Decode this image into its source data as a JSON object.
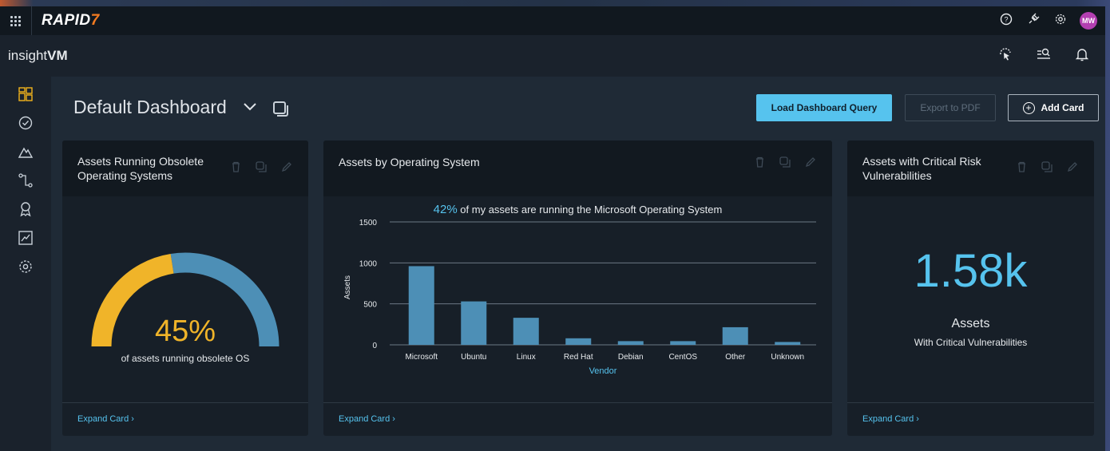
{
  "brand": {
    "name": "RAPID",
    "mark": "7",
    "product_prefix": "insight",
    "product_suffix": "VM",
    "avatar_initials": "MW"
  },
  "brandbar_icons": [
    "help-icon",
    "plug-icon",
    "gear-icon"
  ],
  "productbar_icons": [
    "scan-cursor-icon",
    "search-list-icon",
    "bell-icon"
  ],
  "sidebar": {
    "items": [
      {
        "name": "dashboard",
        "icon": "dashboard-grid-icon",
        "active": true
      },
      {
        "name": "remediation",
        "icon": "check-circle-icon"
      },
      {
        "name": "vulnerabilities",
        "icon": "mountain-icon"
      },
      {
        "name": "automation",
        "icon": "workflow-icon"
      },
      {
        "name": "policies",
        "icon": "ribbon-icon"
      },
      {
        "name": "reports",
        "icon": "trend-chart-icon"
      },
      {
        "name": "administration",
        "icon": "gear-icon"
      }
    ]
  },
  "dashboard": {
    "title": "Default Dashboard",
    "buttons": {
      "load_query": "Load Dashboard Query",
      "export_pdf": "Export to PDF",
      "add_card": "Add Card"
    }
  },
  "cards": {
    "obsolete_os": {
      "title_line1": "Assets Running Obsolete",
      "title_line2": "Operating Systems",
      "percent": 45,
      "percent_label": "45%",
      "subtitle": "of assets running obsolete OS",
      "expand": "Expand Card ›",
      "colors": {
        "obsolete": "#f0b429",
        "other": "#4d8fb6"
      }
    },
    "by_os": {
      "title": "Assets by Operating System",
      "caption_highlight": "42%",
      "caption_rest": " of my assets are running the Microsoft Operating System",
      "expand": "Expand Card ›"
    },
    "critical": {
      "title_line1": "Assets with Critical Risk",
      "title_line2": "Vulnerabilities",
      "value": "1.58k",
      "label": "Assets",
      "sublabel": "With Critical Vulnerabilities",
      "expand": "Expand Card ›"
    }
  },
  "chart_data": {
    "type": "bar",
    "categories": [
      "Microsoft",
      "Ubuntu",
      "Linux",
      "Red Hat",
      "Debian",
      "CentOS",
      "Other",
      "Unknown"
    ],
    "values": [
      960,
      530,
      330,
      80,
      45,
      45,
      215,
      35
    ],
    "xlabel": "Vendor",
    "ylabel": "Assets",
    "ylim": [
      0,
      1500
    ],
    "yticks": [
      0,
      500,
      1000,
      1500
    ],
    "grid": true,
    "bar_color": "#4d8fb6"
  }
}
